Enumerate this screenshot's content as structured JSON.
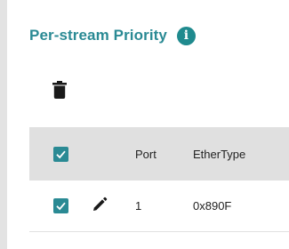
{
  "panel": {
    "title": "Per-stream Priority"
  },
  "icons": {
    "info": "info-icon",
    "delete": "trash-icon",
    "edit": "pencil-icon",
    "check": "checkmark-icon"
  },
  "colors": {
    "accent": "#2a8a94",
    "header_bg": "#e0e0e0"
  },
  "table": {
    "columns": [
      "Port",
      "EtherType"
    ],
    "rows": [
      {
        "port": "1",
        "ethertype": "0x890F",
        "selected": true
      }
    ],
    "select_all": true
  }
}
